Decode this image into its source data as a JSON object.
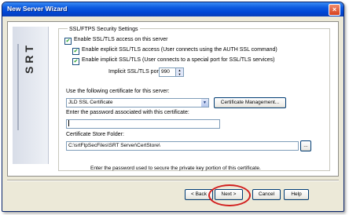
{
  "window": {
    "title": "New Server Wizard",
    "close_icon": "close-icon"
  },
  "logo": "SRT",
  "ssl_group": {
    "title": "SSL/FTPS Security Settings",
    "enable_ssl": {
      "label": "Enable SSL/TLS access on this server",
      "checked": true
    },
    "explicit": {
      "label": "Enable explicit SSL/TLS access (User connects using the AUTH SSL command)",
      "checked": true
    },
    "implicit": {
      "label": "Enable implicit SSL/TLS (User connects to a special port for SSL/TLS services)",
      "checked": true
    },
    "implicit_port_label": "Implicit SSL/TLS port:",
    "implicit_port_value": "990"
  },
  "certificate": {
    "label": "Use the following certificate for this server:",
    "selected": "JLD SSL Certificate",
    "manage_button": "Certificate Management...",
    "password_label": "Enter the password associated with this certificate:",
    "password_value": "",
    "store_label": "Certificate Store Folder:",
    "store_value": "C:\\srtFtpSecFiles\\SRT Server\\CertStore\\",
    "browse_button": "..."
  },
  "status_text": "Enter the password used to secure the private key portion of this certificate.",
  "buttons": {
    "back": "< Back",
    "next": "Next >",
    "cancel": "Cancel",
    "help": "Help"
  },
  "colors": {
    "titlebar": "#0046d5",
    "highlight": "#d21f1f"
  }
}
